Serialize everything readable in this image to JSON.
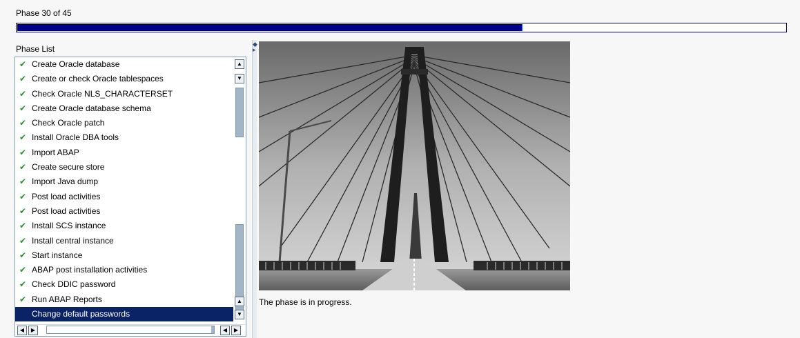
{
  "header": {
    "phase_counter": "Phase 30 of 45",
    "progress_fraction": 0.656,
    "progress_color": "#00008b"
  },
  "phase_list": {
    "title": "Phase List",
    "items": [
      {
        "label": "Create Oracle database",
        "status": "done"
      },
      {
        "label": "Create or check Oracle tablespaces",
        "status": "done"
      },
      {
        "label": "Check Oracle NLS_CHARACTERSET",
        "status": "done"
      },
      {
        "label": "Create Oracle database schema",
        "status": "done"
      },
      {
        "label": "Check Oracle patch",
        "status": "done"
      },
      {
        "label": "Install Oracle DBA tools",
        "status": "done"
      },
      {
        "label": "Import ABAP",
        "status": "done"
      },
      {
        "label": "Create secure store",
        "status": "done"
      },
      {
        "label": "Import Java dump",
        "status": "done"
      },
      {
        "label": "Post load activities",
        "status": "done"
      },
      {
        "label": "Post load activities",
        "status": "done"
      },
      {
        "label": "Install SCS instance",
        "status": "done"
      },
      {
        "label": "Install central instance",
        "status": "done"
      },
      {
        "label": "Start instance",
        "status": "done"
      },
      {
        "label": "ABAP post installation activities",
        "status": "done"
      },
      {
        "label": "Check DDIC password",
        "status": "done"
      },
      {
        "label": "Run ABAP Reports",
        "status": "done"
      },
      {
        "label": "Change default passwords",
        "status": "current"
      }
    ],
    "check_glyph": "✔",
    "selected_color": "#0a2366"
  },
  "main": {
    "image_subject": "cable-stayed bridge photo",
    "status_text": "The phase is in progress."
  }
}
